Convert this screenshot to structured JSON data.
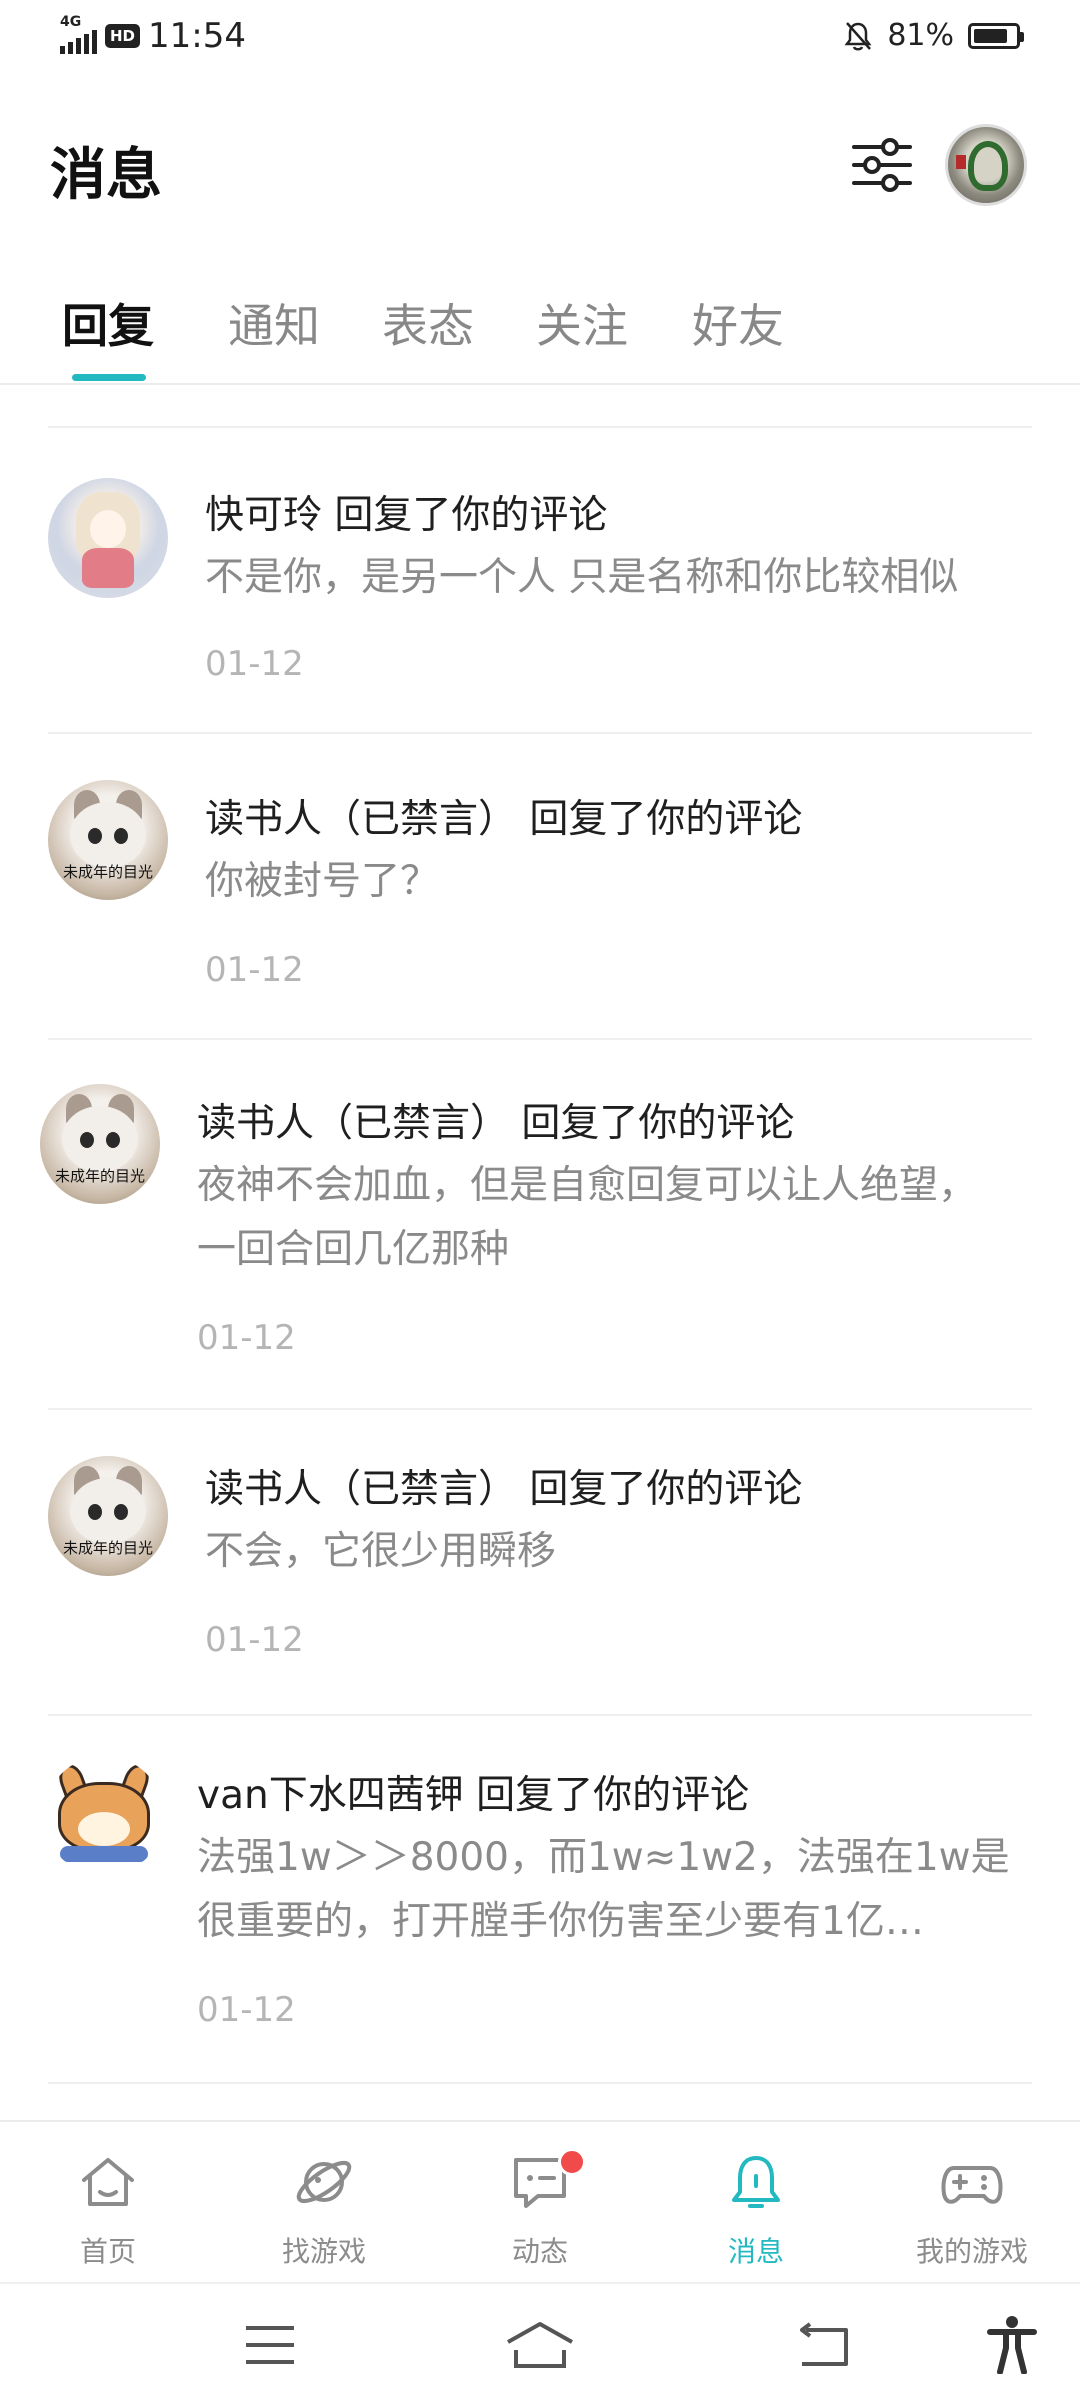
{
  "status_bar": {
    "network": "4G",
    "hd": "HD",
    "time": "11:54",
    "battery_percent": "81%"
  },
  "header": {
    "title": "消息",
    "filter_icon": "filter-sliders-icon",
    "avatar_icon": "user-avatar"
  },
  "tabs": [
    {
      "label": "回复",
      "active": true
    },
    {
      "label": "通知",
      "active": false
    },
    {
      "label": "表态",
      "active": false
    },
    {
      "label": "关注",
      "active": false
    },
    {
      "label": "好友",
      "active": false
    }
  ],
  "messages": [
    {
      "name_line": "快可玲 回复了你的评论",
      "content": "不是你，是另一个人 只是名称和你比较相似",
      "date": "01-12"
    },
    {
      "name_line": "读书人（已禁言） 回复了你的评论",
      "content": "你被封号了？",
      "date": "01-12",
      "avatar_caption": "未成年的目光"
    },
    {
      "name_line": "读书人（已禁言） 回复了你的评论",
      "content": "夜神不会加血，但是自愈回复可以让人绝望，一回合回几亿那种",
      "date": "01-12",
      "avatar_caption": "未成年的目光"
    },
    {
      "name_line": "读书人（已禁言） 回复了你的评论",
      "content": "不会，它很少用瞬移",
      "date": "01-12",
      "avatar_caption": "未成年的目光"
    },
    {
      "name_line": "van下水四茜钾 回复了你的评论",
      "content": "法强1w＞＞8000，而1w≈1w2，法强在1w是很重要的，打开膛手你伤害至少要有1亿…",
      "date": "01-12"
    }
  ],
  "bottom_nav": [
    {
      "label": "首页",
      "icon": "home-icon",
      "active": false
    },
    {
      "label": "找游戏",
      "icon": "planet-icon",
      "active": false
    },
    {
      "label": "动态",
      "icon": "chat-icon",
      "active": false,
      "badge": true
    },
    {
      "label": "消息",
      "icon": "bell-icon",
      "active": true
    },
    {
      "label": "我的游戏",
      "icon": "gamepad-icon",
      "active": false
    }
  ],
  "colors": {
    "accent": "#23b9c0",
    "badge": "#f04a4a"
  }
}
